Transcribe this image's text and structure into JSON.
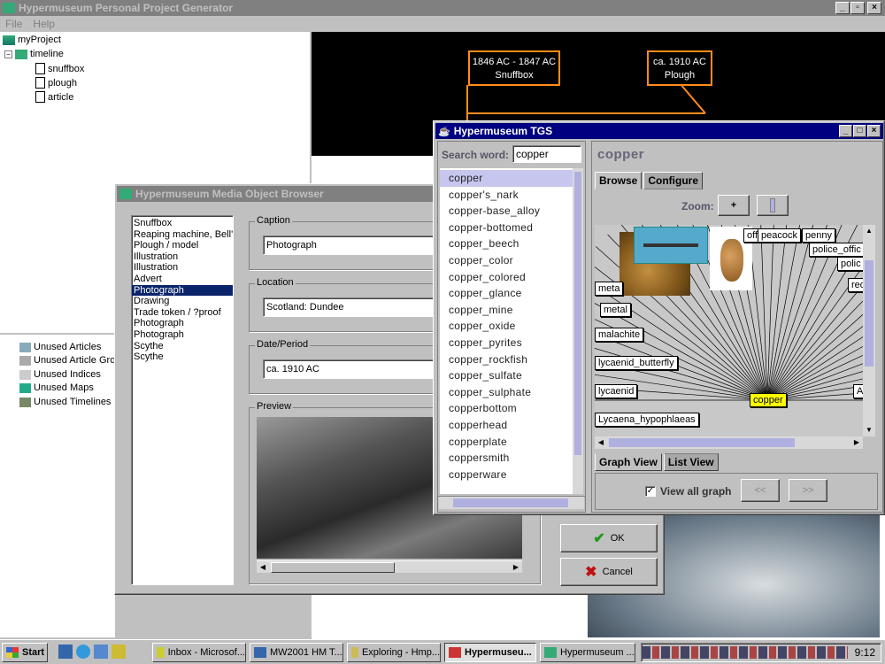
{
  "main_window": {
    "title": "Hypermuseum Personal Project Generator",
    "menu": [
      "File",
      "Help"
    ]
  },
  "project_tree": {
    "root": "myProject",
    "timeline": "timeline",
    "children": [
      "snuffbox",
      "plough",
      "article"
    ]
  },
  "unused_tree": [
    "Unused Articles",
    "Unused Article Gro",
    "Unused Indices",
    "Unused Maps",
    "Unused Timelines"
  ],
  "timeline_view": {
    "boxes": [
      {
        "dates": "1846 AC - 1847 AC",
        "label": "Snuffbox"
      },
      {
        "dates": "ca. 1910 AC",
        "label": "Plough"
      }
    ]
  },
  "browser": {
    "title": "Hypermuseum Media Object Browser",
    "items": [
      "Snuffbox",
      "Reaping machine, Bell's",
      "Plough / model",
      "Illustration",
      "Illustration",
      "Advert",
      "Photograph",
      "Drawing",
      "Trade token / ?proof",
      "Photograph",
      "Photograph",
      "Scythe",
      "Scythe"
    ],
    "selected_index": 6,
    "caption_label": "Caption",
    "caption_value": "Photograph",
    "location_label": "Location",
    "location_value": "Scotland: Dundee",
    "date_label": "Date/Period",
    "date_value": "ca. 1910 AC",
    "preview_label": "Preview",
    "ok_label": "OK",
    "cancel_label": "Cancel"
  },
  "tgs": {
    "title": "Hypermuseum TGS",
    "search_label": "Search word:",
    "search_value": "copper",
    "words": [
      "copper",
      "copper's_nark",
      "copper-base_alloy",
      "copper-bottomed",
      "copper_beech",
      "copper_color",
      "copper_colored",
      "copper_glance",
      "copper_mine",
      "copper_oxide",
      "copper_pyrites",
      "copper_rockfish",
      "copper_sulfate",
      "copper_sulphate",
      "copperbottom",
      "copperhead",
      "copperplate",
      "coppersmith",
      "copperware"
    ],
    "selected_index": 0,
    "browse_button": "Browse",
    "heading": "copper",
    "tabs": [
      "Browse",
      "Configure"
    ],
    "zoom_label": "Zoom:",
    "zoom_plus": "+",
    "graph_center": "copper",
    "graph_nodes": [
      "off",
      "peacock",
      "penny",
      "police_offic",
      "polic",
      "red",
      "meta",
      "metal",
      "malachite",
      "lycaenid_butterfly",
      "lycaenid",
      "Lycaena_hypophlaeas",
      "Ar"
    ],
    "view_tabs": [
      "Graph View",
      "List View"
    ],
    "view_all_label": "View all graph",
    "prev": "<<",
    "next": ">>"
  },
  "taskbar": {
    "start": "Start",
    "tasks": [
      "Inbox - Microsof...",
      "MW2001 HM T...",
      "Exploring - Hmp...",
      "Hypermuseu...",
      "Hypermuseum ..."
    ],
    "active_index": 3,
    "clock": "9:12"
  }
}
